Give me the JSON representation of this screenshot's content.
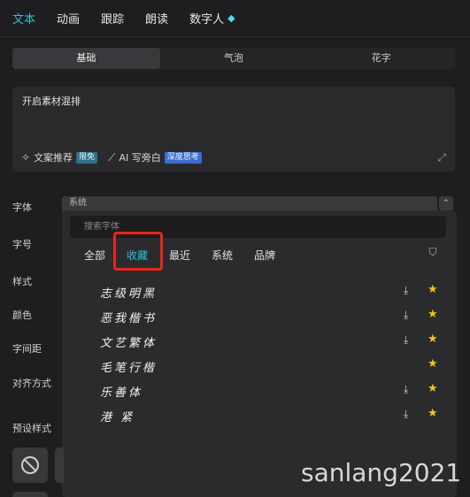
{
  "topbar": {
    "tabs": [
      {
        "label": "文本",
        "active": true
      },
      {
        "label": "动画"
      },
      {
        "label": "跟踪"
      },
      {
        "label": "朗读"
      },
      {
        "label": "数字人"
      }
    ]
  },
  "segment": {
    "items": [
      {
        "label": "基础",
        "active": true
      },
      {
        "label": "气泡"
      },
      {
        "label": "花字"
      }
    ]
  },
  "textbox": {
    "content": "开启素材混排",
    "tool1": "文案推荐",
    "tool1_badge": "限免",
    "tool2": "AI 写旁白",
    "tool2_badge": "深度思考"
  },
  "labels": {
    "font": "字体",
    "size": "字号",
    "style": "样式",
    "color": "颜色",
    "spacing": "字间距",
    "align": "对齐方式",
    "preset": "预设样式"
  },
  "font_select": {
    "value": "系统"
  },
  "dropdown": {
    "search_placeholder": "搜索字体",
    "categories": [
      {
        "label": "全部"
      },
      {
        "label": "收藏",
        "active": true
      },
      {
        "label": "最近"
      },
      {
        "label": "系统"
      },
      {
        "label": "品牌"
      }
    ],
    "fonts": [
      {
        "name": "志级明黑",
        "download": true,
        "favorite": true
      },
      {
        "name": "恶我楷书",
        "download": true,
        "favorite": true
      },
      {
        "name": "文艺繁体",
        "download": true,
        "favorite": true
      },
      {
        "name": "毛笔行楷",
        "download": false,
        "favorite": true
      },
      {
        "name": "乐善体",
        "download": true,
        "favorite": true
      },
      {
        "name": "港 紧",
        "download": true,
        "favorite": true
      }
    ]
  },
  "watermark": "sanlang2021",
  "colors": {
    "accent": "#27c4d8",
    "highlight": "#e8251c",
    "star": "#f2c318"
  }
}
